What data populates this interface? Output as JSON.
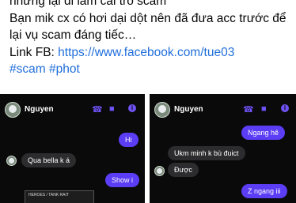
{
  "post": {
    "line1": "nhưng lại đi làm cái trò scam",
    "line2": "Bạn mik cx có hơi dại dột nên đã đưa acc trước để",
    "line3": "lại vụ scam đáng tiếc…",
    "link_label": "Link FB: ",
    "link_url": "https://www.facebook.com/tue03",
    "hashtags": [
      "#scam",
      "#phot"
    ]
  },
  "screenshots": [
    {
      "contact_name": "Nguyen",
      "messages": [
        {
          "dir": "out",
          "text": "Hi"
        },
        {
          "dir": "in",
          "text": "Qua bella k á"
        },
        {
          "dir": "out",
          "text": "Show i"
        }
      ],
      "sticker_text": "HEROES / TANK RAIT"
    },
    {
      "contact_name": "Nguyen",
      "messages": [
        {
          "dir": "out",
          "text": "Ngang hê"
        },
        {
          "dir": "in",
          "text": "Ukm minh k bù đuict"
        },
        {
          "dir": "in",
          "text": "Được"
        },
        {
          "dir": "out",
          "text": "Z ngang iii"
        }
      ]
    }
  ],
  "colors": {
    "link": "#216fdb",
    "accent": "#6f52f5",
    "bubble_out": "#5b3df5",
    "bubble_in": "#2c2c2e"
  }
}
